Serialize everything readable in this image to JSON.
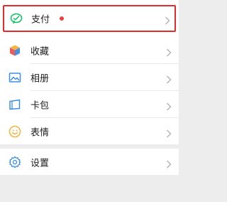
{
  "menu": {
    "pay": {
      "label": "支付",
      "badge": true,
      "icon": "pay-icon"
    },
    "items": [
      {
        "label": "收藏",
        "icon": "favorites-cube-icon"
      },
      {
        "label": "相册",
        "icon": "album-icon"
      },
      {
        "label": "卡包",
        "icon": "card-wallet-icon"
      },
      {
        "label": "表情",
        "icon": "emoji-smile-icon"
      }
    ],
    "settings": {
      "label": "设置",
      "icon": "settings-gear-icon"
    }
  },
  "colors": {
    "highlight_border": "#e12c2c",
    "badge": "#e64340",
    "pay_green": "#07c160",
    "background": "#ededed"
  }
}
